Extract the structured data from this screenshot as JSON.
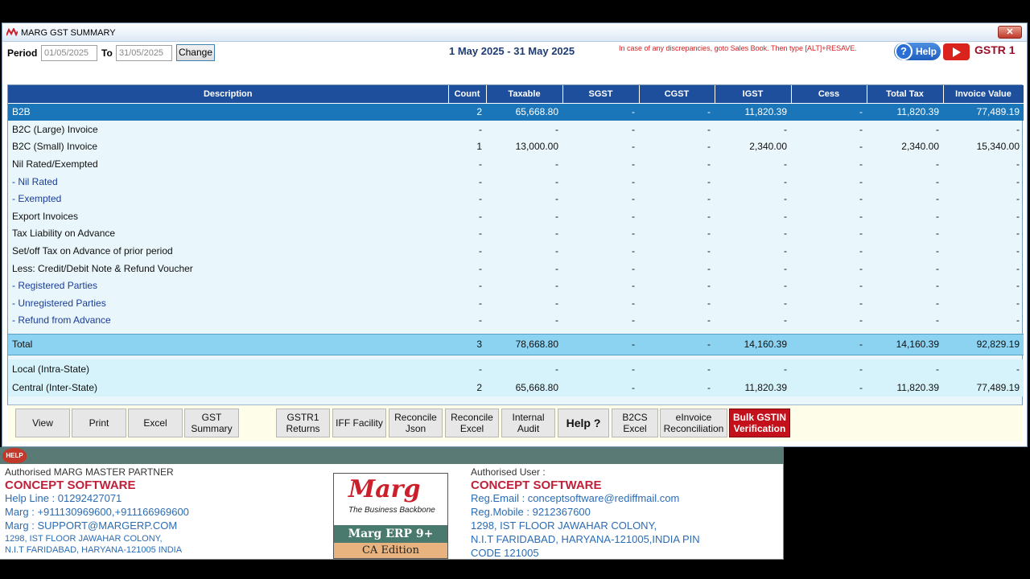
{
  "window": {
    "title": "MARG GST SUMMARY",
    "close": "✕"
  },
  "toolbar": {
    "period_label": "Period",
    "from_date": "01/05/2025",
    "to_label": "To",
    "to_date": "31/05/2025",
    "change_label": "Change",
    "period_range": "1 May 2025 - 31 May 2025",
    "warning": "In case of any discrepancies, goto Sales Book. Then type [ALT]+RESAVE.",
    "help_label": "Help",
    "report_name": "GSTR 1"
  },
  "table": {
    "headers": [
      "Description",
      "Count",
      "Taxable",
      "SGST",
      "CGST",
      "IGST",
      "Cess",
      "Total Tax",
      "Invoice Value"
    ],
    "rows": [
      [
        "B2B",
        "2",
        "65,668.80",
        "-",
        "-",
        "11,820.39",
        "-",
        "11,820.39",
        "77,489.19"
      ],
      [
        "B2C (Large) Invoice",
        "-",
        "-",
        "-",
        "-",
        "-",
        "-",
        "-",
        "-"
      ],
      [
        "B2C (Small) Invoice",
        "1",
        "13,000.00",
        "-",
        "-",
        "2,340.00",
        "-",
        "2,340.00",
        "15,340.00"
      ],
      [
        "Nil Rated/Exempted",
        "-",
        "-",
        "-",
        "-",
        "-",
        "-",
        "-",
        "-"
      ],
      [
        " - Nil Rated",
        "-",
        "-",
        "-",
        "-",
        "-",
        "-",
        "-",
        "-"
      ],
      [
        " - Exempted",
        "-",
        "-",
        "-",
        "-",
        "-",
        "-",
        "-",
        "-"
      ],
      [
        "Export Invoices",
        "-",
        "-",
        "-",
        "-",
        "-",
        "-",
        "-",
        "-"
      ],
      [
        "Tax Liability on Advance",
        "-",
        "-",
        "-",
        "-",
        "-",
        "-",
        "-",
        "-"
      ],
      [
        "Set/off Tax on Advance of prior period",
        "-",
        "-",
        "-",
        "-",
        "-",
        "-",
        "-",
        "-"
      ],
      [
        "Less: Credit/Debit Note & Refund Voucher",
        "-",
        "-",
        "-",
        "-",
        "-",
        "-",
        "-",
        "-"
      ],
      [
        " - Registered Parties",
        "-",
        "-",
        "-",
        "-",
        "-",
        "-",
        "-",
        "-"
      ],
      [
        " - Unregistered Parties",
        "-",
        "-",
        "-",
        "-",
        "-",
        "-",
        "-",
        "-"
      ],
      [
        " - Refund from Advance",
        "-",
        "-",
        "-",
        "-",
        "-",
        "-",
        "-",
        "-"
      ]
    ],
    "total": [
      "Total",
      "3",
      "78,668.80",
      "-",
      "-",
      "14,160.39",
      "-",
      "14,160.39",
      "92,829.19"
    ],
    "local": [
      "Local (Intra-State)",
      "-",
      "-",
      "-",
      "-",
      "-",
      "-",
      "-",
      "-"
    ],
    "central": [
      "Central (Inter-State)",
      "2",
      "65,668.80",
      "-",
      "-",
      "11,820.39",
      "-",
      "11,820.39",
      "77,489.19"
    ]
  },
  "buttons": {
    "view": "View",
    "print": "Print",
    "excel": "Excel",
    "gst_summary": "GST Summary",
    "gstr1_returns": "GSTR1 Returns",
    "iff": "IFF Facility",
    "reconcile_json": "Reconcile Json",
    "reconcile_excel": "Reconcile Excel",
    "internal_audit": "Internal Audit",
    "help": "Help ?",
    "b2cs_excel": "B2CS Excel",
    "einvoice": "eInvoice Reconciliation",
    "bulk_gstin": "Bulk GSTIN Verification"
  },
  "info": {
    "help_badge": "HELP",
    "left": {
      "heading": "Authorised MARG MASTER PARTNER",
      "company": "CONCEPT SOFTWARE",
      "helpline": "Help Line : 01292427071",
      "marg_phone": "Marg : +911130969600,+911166969600",
      "marg_email": "Marg : SUPPORT@MARGERP.COM",
      "addr1": "1298, IST FLOOR JAWAHAR COLONY,",
      "addr2": "N.I.T FARIDABAD, HARYANA-121005 INDIA"
    },
    "logo": {
      "word": "Marg",
      "tagline": "The Business Backbone",
      "product": "Marg ERP 9+",
      "edition": "CA Edition"
    },
    "right": {
      "heading": "Authorised User :",
      "company": "CONCEPT SOFTWARE",
      "email": "Reg.Email : conceptsoftware@rediffmail.com",
      "mobile": "Reg.Mobile : 9212367600",
      "addr1": "1298, IST FLOOR JAWAHAR COLONY,",
      "addr2": " N.I.T FARIDABAD, HARYANA-121005,INDIA PIN",
      "addr3": "CODE 121005"
    }
  },
  "colors": {
    "header_blue": "#1e4f9c",
    "selected_row": "#1a76b9",
    "total_row": "#8bd3f1",
    "accent_red": "#c0203a"
  }
}
